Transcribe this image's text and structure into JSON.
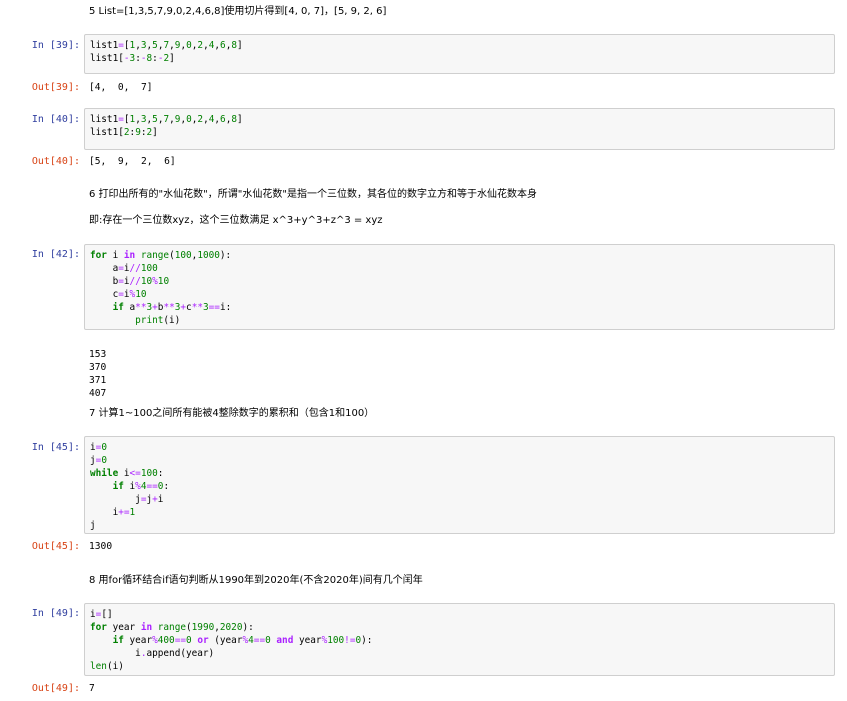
{
  "markdown": {
    "q5": "5 List=[1,3,5,7,9,0,2,4,6,8]使用切片得到[4, 0, 7]，[5, 9, 2, 6]",
    "q6a": "6 打印出所有的\"水仙花数\"，所谓\"水仙花数\"是指一个三位数，其各位的数字立方和等于水仙花数本身",
    "q6b": "即:存在一个三位数xyz，这个三位数满足 x^3+y^3+z^3 = xyz",
    "q7": "7 计算1~100之间所有能被4整除数字的累积和（包含1和100）",
    "q8": "8 用for循环结合if语句判断从1990年到2020年(不含2020年)间有几个闰年"
  },
  "cells": {
    "c39": {
      "in_prompt": "In  [39]:",
      "out_prompt": "Out[39]:",
      "code": [
        "list1=[1,3,5,7,9,0,2,4,6,8]",
        "list1[-3:-8:-2]"
      ],
      "output": "[4,  0,  7]"
    },
    "c40": {
      "in_prompt": "In  [40]:",
      "out_prompt": "Out[40]:",
      "code": [
        "list1=[1,3,5,7,9,0,2,4,6,8]",
        "list1[2:9:2]"
      ],
      "output": "[5,  9,  2,  6]"
    },
    "c42": {
      "in_prompt": "In  [42]:",
      "code": [
        "for i in range(100,1000):",
        "    a=i//100",
        "    b=i//10%10",
        "    c=i%10",
        "    if a**3+b**3+c**3==i:",
        "        print(i)"
      ],
      "stdout": [
        "153",
        "370",
        "371",
        "407"
      ]
    },
    "c45": {
      "in_prompt": "In  [45]:",
      "out_prompt": "Out[45]:",
      "code": [
        "i=0",
        "j=0",
        "while i<=100:",
        "    if i%4==0:",
        "        j=j+i",
        "    i+=1",
        "j"
      ],
      "output": "1300"
    },
    "c49": {
      "in_prompt": "In  [49]:",
      "out_prompt": "Out[49]:",
      "code": [
        "i=[]",
        "for year in range(1990,2020):",
        "    if year%400==0 or (year%4==0 and year%100!=0):",
        "        i.append(year)",
        "len(i)"
      ],
      "output": "7"
    }
  },
  "colors": {
    "in_prompt": "#303f9f",
    "out_prompt": "#d84315",
    "keyword": "#008000",
    "operator": "#aa22ff",
    "cell_bg": "#f7f7f7",
    "cell_border": "#cfcfcf"
  }
}
